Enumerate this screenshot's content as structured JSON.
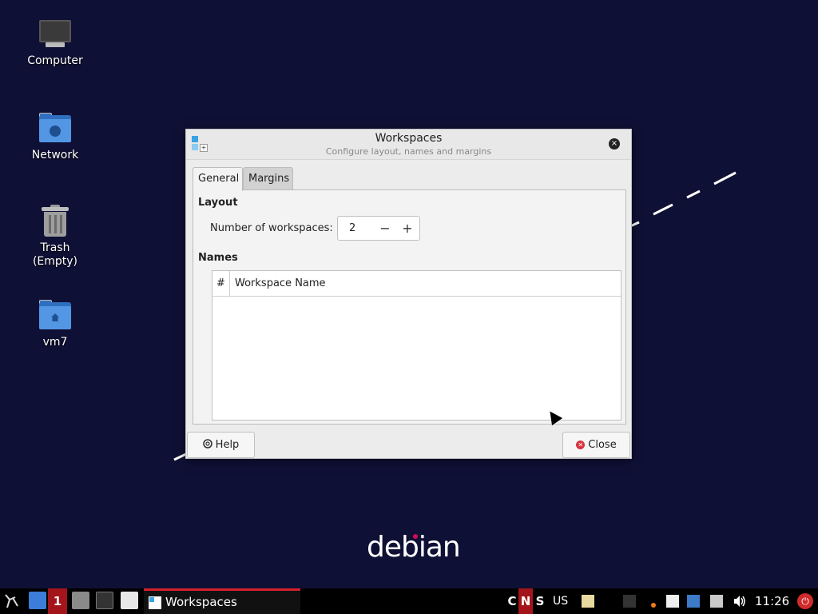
{
  "desktop": {
    "icons": [
      {
        "label": "Computer"
      },
      {
        "label": "Network"
      },
      {
        "label": "Trash",
        "sublabel": "(Empty)"
      },
      {
        "label": "vm7"
      }
    ],
    "wallpaper_text": "debian"
  },
  "dialog": {
    "title": "Workspaces",
    "subtitle": "Configure layout, names and margins",
    "close_glyph": "×",
    "tabs": [
      {
        "label": "General",
        "active": true
      },
      {
        "label": "Margins",
        "active": false
      }
    ],
    "layout": {
      "heading": "Layout",
      "workspaces_label": "Number of workspaces:",
      "workspaces_value": "2",
      "decrement_glyph": "−",
      "increment_glyph": "+"
    },
    "names": {
      "heading": "Names",
      "columns": [
        "#",
        "Workspace Name"
      ],
      "rows": []
    },
    "buttons": {
      "help": "Help",
      "close": "Close"
    }
  },
  "taskbar": {
    "workspace_number": "1",
    "active_task": "Workspaces",
    "indicators": [
      "C",
      "N",
      "S"
    ],
    "keyboard_layout": "US",
    "clock": "11:26"
  },
  "colors": {
    "desktop_bg": "#0f1035",
    "accent_red": "#a3151a",
    "folder_blue": "#5296e4"
  }
}
